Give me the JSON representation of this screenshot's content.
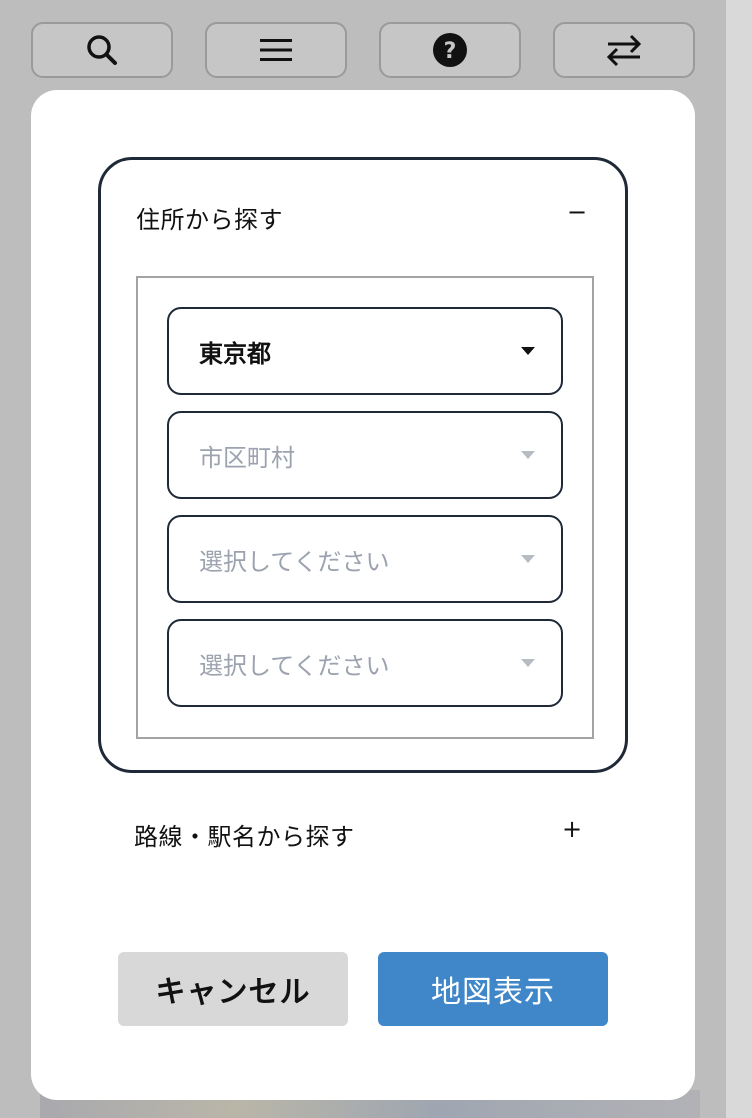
{
  "toolbar": {
    "icons": [
      "search-icon",
      "menu-icon",
      "help-icon",
      "swap-icon"
    ]
  },
  "address_search": {
    "title": "住所から探す",
    "toggle": "−",
    "selects": [
      {
        "value": "東京都",
        "state": "selected"
      },
      {
        "value": "市区町村",
        "state": "placeholder"
      },
      {
        "value": "選択してください",
        "state": "placeholder"
      },
      {
        "value": "選択してください",
        "state": "placeholder"
      }
    ]
  },
  "line_search": {
    "title": "路線・駅名から探す",
    "toggle": "+"
  },
  "buttons": {
    "cancel": "キャンセル",
    "show_map": "地図表示"
  },
  "colors": {
    "primary": "#3f87c9",
    "cancel_bg": "#d8d8d8",
    "border_dark": "#1f2937",
    "placeholder": "#9ca3af"
  }
}
